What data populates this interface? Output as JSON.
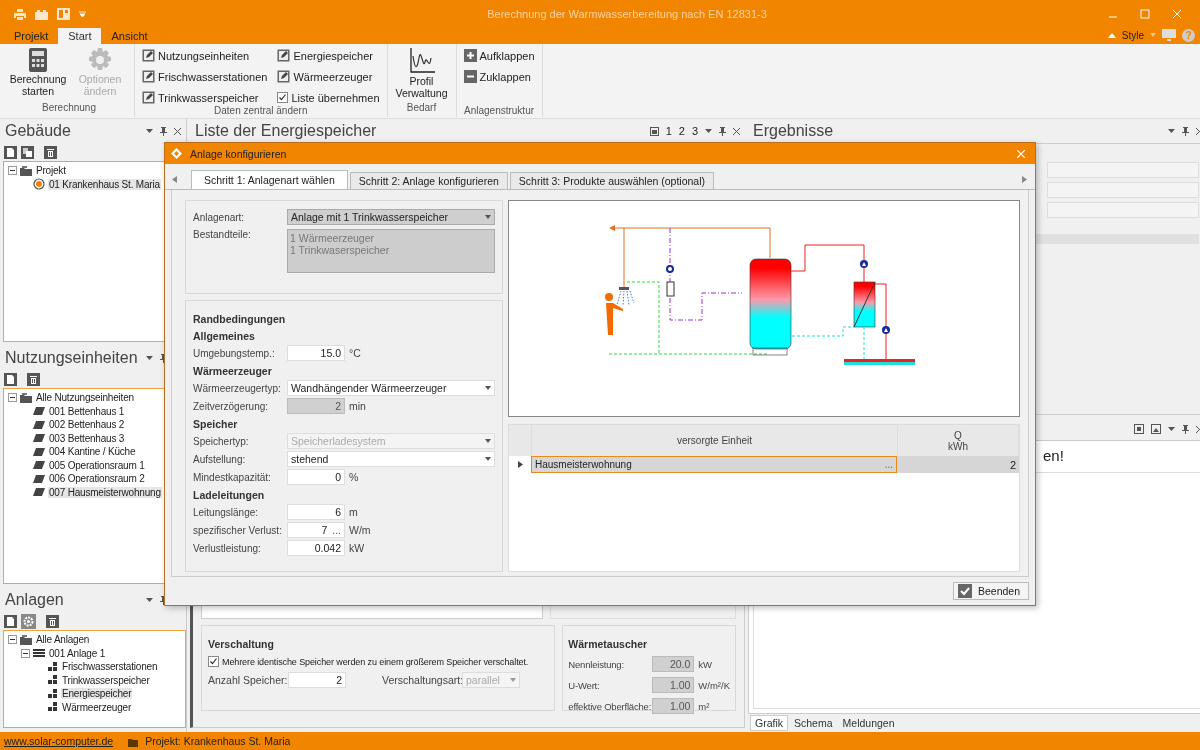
{
  "window": {
    "title": "Berechnung der Warmwasserbereitung nach EN 12831-3"
  },
  "ribbon": {
    "tabs": [
      {
        "label": "Projekt",
        "selected": false
      },
      {
        "label": "Start",
        "selected": true
      },
      {
        "label": "Ansicht",
        "selected": false
      }
    ],
    "style_menu": "Style",
    "help": "?",
    "groups": [
      {
        "label": "Berechnung",
        "kind": "large",
        "items": [
          {
            "kind": "calculate",
            "label": "Berechnung starten",
            "disabled": false
          },
          {
            "kind": "options",
            "label": "Optionen ändern",
            "disabled": true
          }
        ]
      },
      {
        "label": "Daten zentral ändern",
        "kind": "list",
        "items": [
          {
            "kind": "edit",
            "label": "Nutzungseinheiten"
          },
          {
            "kind": "edit",
            "label": "Frischwasserstationen"
          },
          {
            "kind": "edit",
            "label": "Trinkwasserspeicher"
          },
          {
            "kind": "edit",
            "label": "Energiespeicher"
          },
          {
            "kind": "edit",
            "label": "Wärmeerzeuger"
          },
          {
            "kind": "checkbox",
            "label": "Liste übernehmen",
            "checked": true
          }
        ]
      },
      {
        "label": "Bedarf",
        "kind": "large",
        "items": [
          {
            "kind": "profile",
            "label": "Profil Verwaltung",
            "disabled": false
          }
        ]
      },
      {
        "label": "Anlagenstruktur",
        "kind": "list",
        "items": [
          {
            "kind": "expand",
            "label": "Aufklappen"
          },
          {
            "kind": "collapse",
            "label": "Zuklappen"
          }
        ]
      }
    ]
  },
  "side_panels": [
    {
      "title": "Gebäude",
      "toolbar": [
        {
          "kind": "new"
        },
        {
          "kind": "copy"
        },
        {
          "kind": "delete"
        }
      ],
      "tree": [
        {
          "label": "Projekt",
          "kind": "folder",
          "expanded": true,
          "selected": false,
          "children": [
            {
              "label": "01 Krankenhaus St. Maria",
              "kind": "building",
              "selected": true
            }
          ]
        }
      ]
    },
    {
      "title": "Nutzungseinheiten",
      "toolbar": [
        {
          "kind": "new"
        },
        {
          "kind": "delete"
        }
      ],
      "tree": [
        {
          "label": "Alle Nutzungseinheiten",
          "kind": "folder",
          "expanded": true,
          "selected": false,
          "children": [
            {
              "label": "001 Bettenhaus 1",
              "kind": "unit",
              "selected": false
            },
            {
              "label": "002 Bettenhaus 2",
              "kind": "unit",
              "selected": false
            },
            {
              "label": "003 Bettenhaus 3",
              "kind": "unit",
              "selected": false
            },
            {
              "label": "004 Kantine / Küche",
              "kind": "unit",
              "selected": false
            },
            {
              "label": "005 Operationsraum 1",
              "kind": "unit",
              "selected": false
            },
            {
              "label": "006 Operationsraum 2",
              "kind": "unit",
              "selected": false
            },
            {
              "label": "007 Hausmeisterwohnung",
              "kind": "unit",
              "selected": true
            }
          ]
        }
      ]
    },
    {
      "title": "Anlagen",
      "toolbar": [
        {
          "kind": "new"
        },
        {
          "kind": "settings"
        },
        {
          "kind": "delete"
        }
      ],
      "tree": [
        {
          "label": "Alle Anlagen",
          "kind": "folder",
          "expanded": true,
          "selected": false,
          "children": [
            {
              "label": "001 Anlage 1",
              "kind": "plant",
              "expanded": true,
              "selected": false,
              "children": [
                {
                  "label": "Frischwasserstationen",
                  "kind": "component",
                  "selected": false
                },
                {
                  "label": "Trinkwasserspeicher",
                  "kind": "component",
                  "selected": false
                },
                {
                  "label": "Energiespeicher",
                  "kind": "component",
                  "selected": true
                },
                {
                  "label": "Wärmeerzeuger",
                  "kind": "component",
                  "selected": false
                }
              ]
            }
          ]
        }
      ]
    }
  ],
  "storage_panel": {
    "title": "Liste der Energiespeicher",
    "pages": [
      "1",
      "2",
      "3"
    ],
    "interconnection": {
      "title": "Verschaltung",
      "checkbox": {
        "label": "Mehrere identische Speicher werden zu einem größerem Speicher verschaltet.",
        "checked": true
      },
      "count_label": "Anzahl Speicher:",
      "count": "2",
      "type_label": "Verschaltungsart:",
      "type": "parallel",
      "type_disabled": true
    },
    "heat_exchanger": {
      "title": "Wärmetauscher",
      "fields": [
        {
          "label": "Nennleistung:",
          "value": "20.0",
          "unit": "kW",
          "disabled": true
        },
        {
          "label": "U-Wert:",
          "value": "1.00",
          "unit": "W/m²/K",
          "disabled": true
        },
        {
          "label": "effektive Oberfläche:",
          "value": "1.00",
          "unit": "m²",
          "disabled": true
        }
      ]
    }
  },
  "results_panel": {
    "title": "Ergebnisse"
  },
  "message_panel": {
    "text": "en!"
  },
  "bottom_tabs": [
    {
      "label": "Grafik",
      "selected": true
    },
    {
      "label": "Schema",
      "selected": false
    },
    {
      "label": "Meldungen",
      "selected": false
    }
  ],
  "dialog": {
    "title": "Anlage konfigurieren",
    "tabs": [
      {
        "label": "Schritt 1: Anlagenart wählen",
        "selected": true
      },
      {
        "label": "Schritt 2: Anlage konfigurieren",
        "selected": false
      },
      {
        "label": "Schritt 3: Produkte auswählen (optional)",
        "selected": false
      }
    ],
    "plant_type": {
      "label": "Anlagenart:",
      "value": "Anlage mit 1 Trinkwasserspeicher"
    },
    "components": {
      "label": "Bestandteile:",
      "lines": [
        "1 Wärmeerzeuger",
        "1 Trinkwaserspeicher"
      ]
    },
    "conditions_title": "Randbedingungen",
    "sections": [
      {
        "title": "Allgemeines",
        "fields": [
          {
            "label": "Umgebungstemp.:",
            "kind": "number",
            "value": "15.0",
            "unit": "°C",
            "disabled": false
          }
        ]
      },
      {
        "title": "Wärmeerzeuger",
        "fields": [
          {
            "label": "Wärmeerzeugertyp:",
            "kind": "dropdown",
            "value": "Wandhängender Wärmeerzeuger",
            "disabled": false
          },
          {
            "label": "Zeitverzögerung:",
            "kind": "number",
            "value": "2",
            "unit": "min",
            "disabled": true
          }
        ]
      },
      {
        "title": "Speicher",
        "fields": [
          {
            "label": "Speichertyp:",
            "kind": "dropdown",
            "value": "Speicherladesystem",
            "disabled": true
          },
          {
            "label": "Aufstellung:",
            "kind": "dropdown",
            "value": "stehend",
            "disabled": false
          },
          {
            "label": "Mindestkapazität:",
            "kind": "number",
            "value": "0",
            "unit": "%",
            "disabled": false
          }
        ]
      },
      {
        "title": "Ladeleitungen",
        "fields": [
          {
            "label": "Leitungslänge:",
            "kind": "number",
            "value": "6",
            "unit": "m",
            "disabled": false
          },
          {
            "label": "spezifischer Verlust:",
            "kind": "picker",
            "value": "7",
            "button": "...",
            "unit": "W/m",
            "disabled": false
          },
          {
            "label": "Verlustleistung:",
            "kind": "number",
            "value": "0.042",
            "unit": "kW",
            "disabled": false
          }
        ]
      }
    ],
    "table": {
      "columns": [
        {
          "label": "versorgte Einheit"
        },
        {
          "label": "Q",
          "unit": "kWh"
        }
      ],
      "rows": [
        {
          "cells": [
            "Hausmeisterwohnung",
            "2"
          ],
          "button": "...",
          "selected": true
        }
      ]
    },
    "finish_button": "Beenden"
  },
  "status_bar": {
    "link": "www.solar-computer.de",
    "project": "Projekt: Krankenhaus St. Maria"
  }
}
